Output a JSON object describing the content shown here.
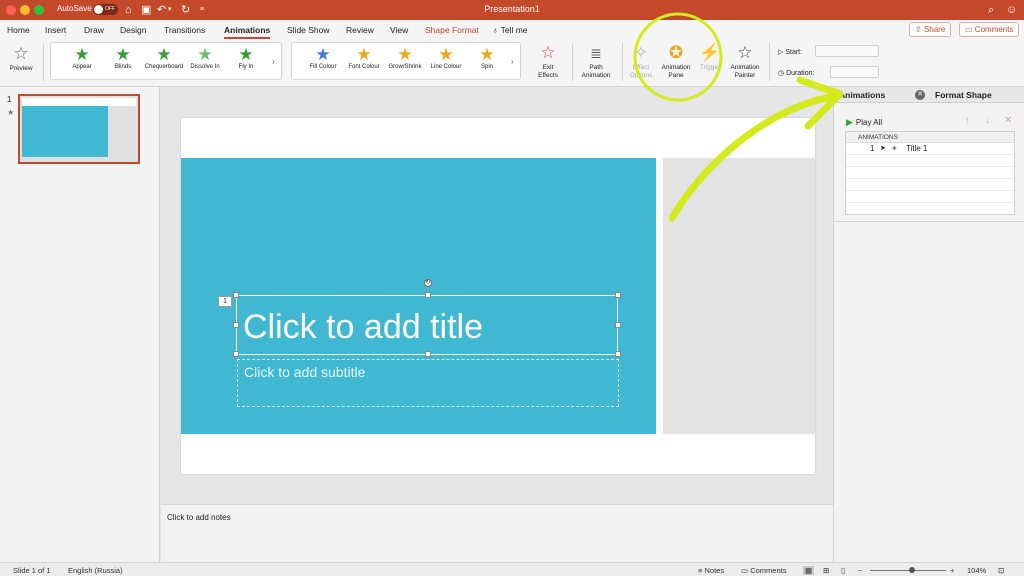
{
  "titlebar": {
    "autosave": "AutoSave",
    "toggle_state": "OFF",
    "doc_title": "Presentation1",
    "icons": [
      "home-icon",
      "save-icon",
      "undo-icon",
      "redo-icon",
      "customize-icon",
      "search-icon",
      "smiley-icon"
    ]
  },
  "tabs": [
    "Home",
    "Insert",
    "Draw",
    "Design",
    "Transitions",
    "Animations",
    "Slide Show",
    "Review",
    "View",
    "Shape Format"
  ],
  "active_tab": "Animations",
  "tell_me": "Tell me",
  "share": "Share",
  "comments_btn": "Comments",
  "ribbon": {
    "preview": "Preview",
    "entrance": [
      {
        "label": "Appear",
        "color": "#3a9d3a"
      },
      {
        "label": "Blinds",
        "color": "#3a9d3a"
      },
      {
        "label": "Chequerboard",
        "color": "#3a9d3a"
      },
      {
        "label": "Dissolve In",
        "color": "#3a9d3a"
      },
      {
        "label": "Fly In",
        "color": "#3a9d3a"
      }
    ],
    "emphasis": [
      {
        "label": "Fill Colour",
        "color": "#e5a91a"
      },
      {
        "label": "Font Colour",
        "color": "#e5a91a"
      },
      {
        "label": "Grow/Shrink",
        "color": "#e5a91a"
      },
      {
        "label": "Line Colour",
        "color": "#e5a91a"
      },
      {
        "label": "Spin",
        "color": "#e5a91a"
      }
    ],
    "exit_effects": "Exit\nEffects",
    "path_animation": "Path\nAnimation",
    "effect_options": "Effect\nOptions",
    "animation_pane": "Animation\nPane",
    "trigger": "Trigger",
    "animation_painter": "Animation\nPainter",
    "start": "Start:",
    "duration": "Duration:"
  },
  "thumb": {
    "number": "1",
    "star": "★"
  },
  "slide": {
    "anim_tag": "1",
    "title": "Click to add title",
    "subtitle": "Click to add subtitle",
    "blue": "#40b8d2"
  },
  "notes": "Click to add notes",
  "pane": {
    "tab_animations": "Animations",
    "tab_format": "Format Shape",
    "play_all": "Play All",
    "list_header": "ANIMATIONS",
    "items": [
      {
        "num": "1",
        "title": "Title 1"
      }
    ]
  },
  "status": {
    "slide": "Slide 1 of 1",
    "language": "English (Russia)",
    "notes": "Notes",
    "comments": "Comments",
    "zoom": "104%",
    "zoom_fraction": 0.55
  },
  "annotation_color": "#d3ea1c",
  "brand": "#c4492a"
}
